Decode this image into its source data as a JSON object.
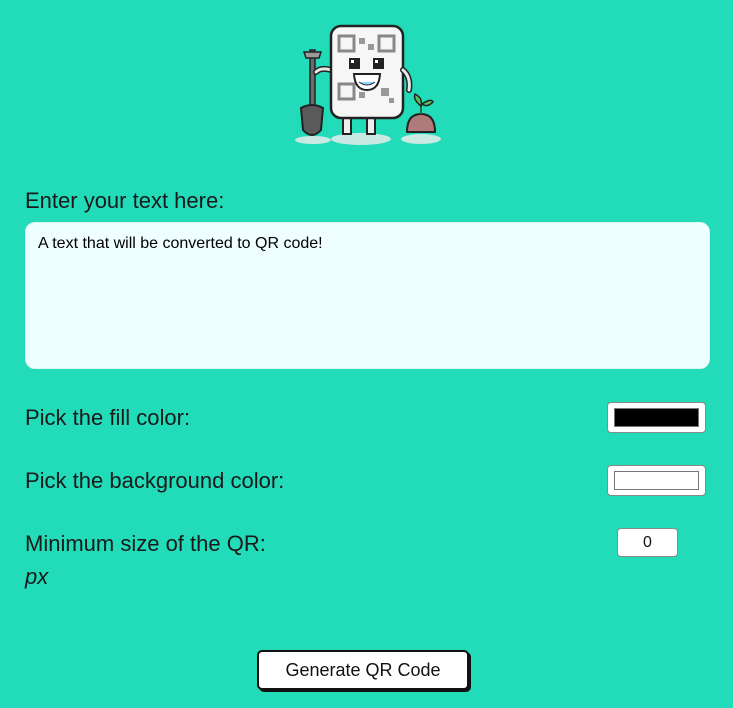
{
  "mascot": {
    "icon": "qr-mascot-gardener-icon"
  },
  "text_label": "Enter your text here:",
  "text_value": "A text that will be converted to QR code!",
  "fill_label": "Pick the fill color:",
  "fill_color": "#000000",
  "bg_label": "Pick the background color:",
  "bg_color": "#ffffff",
  "size_label": "Minimum size of the QR:",
  "size_value": "0",
  "size_unit": "px",
  "generate_label": "Generate QR Code",
  "colors": {
    "page_bg": "#21dbb9",
    "textarea_bg": "#efffff"
  }
}
